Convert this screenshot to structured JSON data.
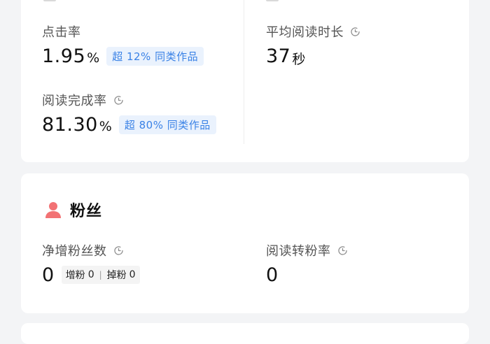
{
  "engagement": {
    "click_rate": {
      "label": "点击率",
      "value": "1.95",
      "unit": "%",
      "badge": "超 12% 同类作品"
    },
    "avg_read_time": {
      "label": "平均阅读时长",
      "value": "37",
      "unit": "秒",
      "icon": "clock-icon"
    },
    "read_completion": {
      "label": "阅读完成率",
      "value": "81.30",
      "unit": "%",
      "badge": "超 80% 同类作品",
      "icon": "clock-icon"
    }
  },
  "fans": {
    "title": "粉丝",
    "icon": "person-icon",
    "net_gain": {
      "label": "净增粉丝数",
      "value": "0",
      "gain_label": "增粉",
      "gain_value": "0",
      "loss_label": "掉粉",
      "loss_value": "0",
      "icon": "clock-icon"
    },
    "read_to_fan_rate": {
      "label": "阅读转粉率",
      "value": "0",
      "icon": "clock-icon"
    }
  },
  "colors": {
    "accent_blue": "#3a82e6",
    "badge_bg": "#eaf2fd",
    "fan_icon": "#f27274",
    "page_bg": "#f3f4f6"
  }
}
